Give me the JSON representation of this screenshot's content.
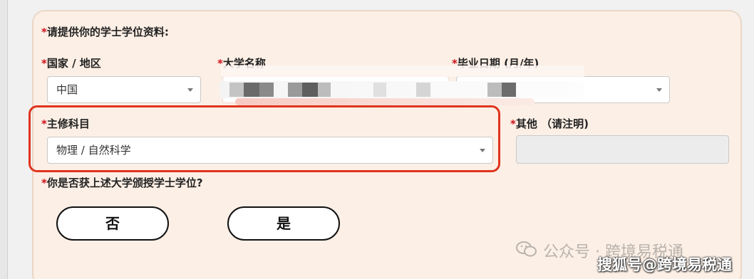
{
  "form": {
    "section_title": "请提供你的学士学位资料:",
    "required_mark": "*",
    "country": {
      "label": "国家 / 地区",
      "value": "中国"
    },
    "university": {
      "label": "大学名称"
    },
    "graduation": {
      "label": "毕业日期 (月/年)"
    },
    "major": {
      "label": "主修科目",
      "value": "物理 / 自然科学"
    },
    "other": {
      "label": "其他 （请注明)"
    },
    "question": "你是否获上述大学颁授学士学位?",
    "no_button": "否",
    "yes_button": "是"
  },
  "watermark": {
    "line1": "公众号 · 跨境易税通",
    "line2": "搜狐号@跨境易税通"
  },
  "colors": {
    "card_bg": "#fcefe5",
    "highlight": "#e0341e",
    "required": "#d0121b"
  }
}
